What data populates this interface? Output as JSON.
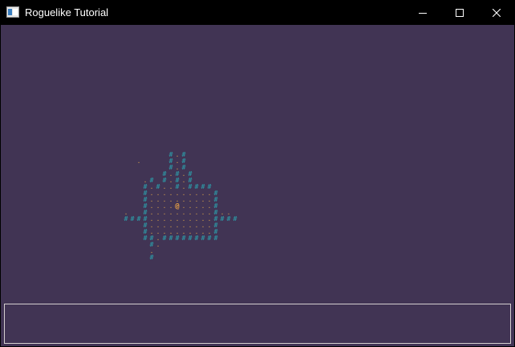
{
  "window": {
    "title": "Roguelike Tutorial",
    "icon": "app-window-icon",
    "controls": [
      "minimize-icon",
      "maximize-icon",
      "close-icon"
    ]
  },
  "colors": {
    "background": "#413454",
    "wall": "#2f8e9e",
    "floor": "#d9a24a",
    "player": "#e8a043",
    "log_border": "#d4cfcf"
  },
  "glyphs": {
    "wall": "#",
    "floor": ".",
    "player": "@"
  },
  "map": {
    "rows": [
      "       #.#        ",
      "  .    #.#        ",
      "       #.#        ",
      "      #.#.#       ",
      "   .# #.#.#       ",
      "   #.#..#.####    ",
      "   #..........#   ",
      "   #..........#   ",
      "   #....@.....#   ",
      ".  #..........#.. ",
      "####..........####",
      "   #..........#   ",
      "   #..........#   ",
      "   ##.#########   ",
      "    #.            ",
      "    .             ",
      "    #             "
    ]
  },
  "message_log": {
    "messages": []
  }
}
